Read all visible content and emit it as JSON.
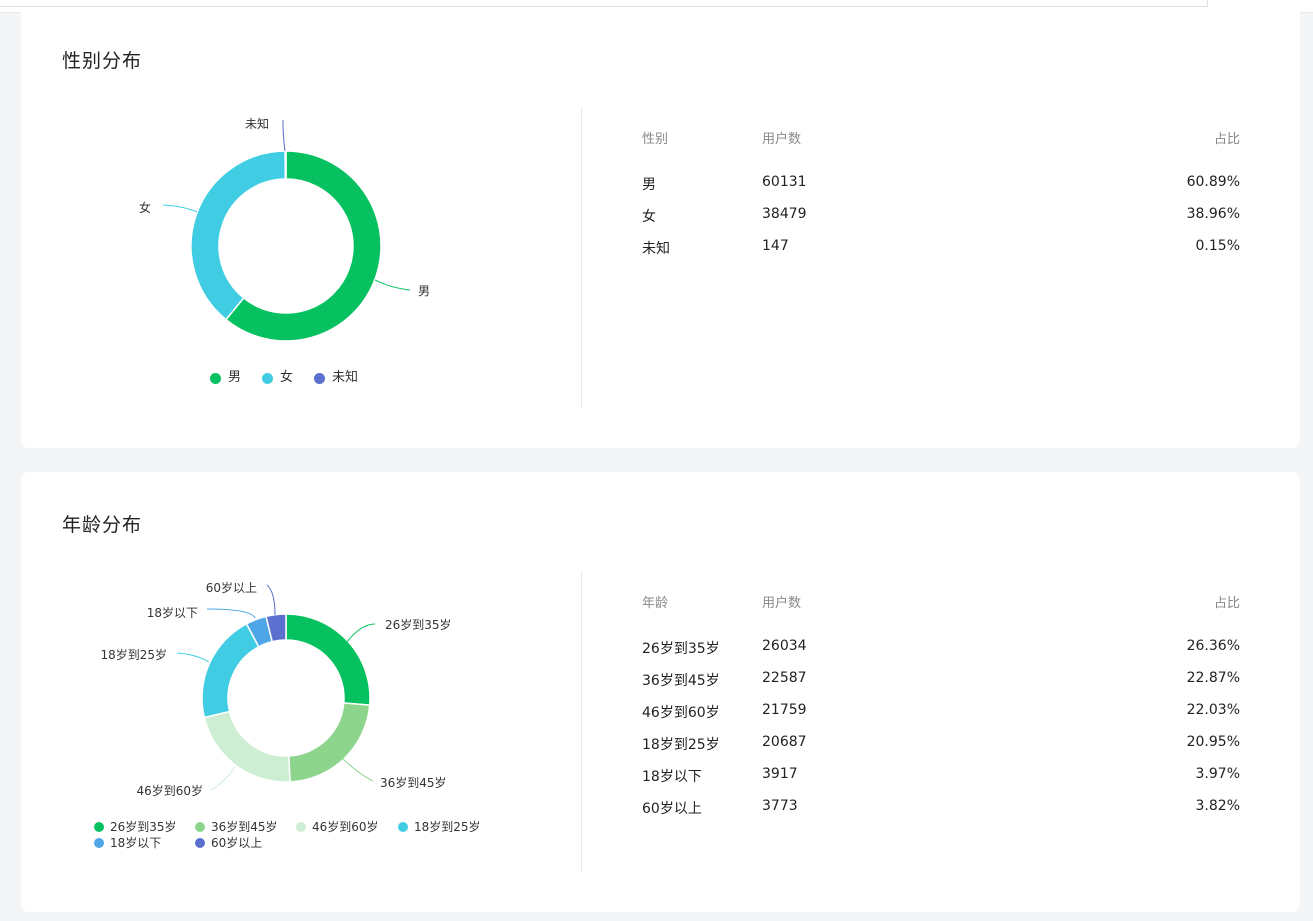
{
  "gender": {
    "title": "性别分布",
    "table": {
      "headers": [
        "性别",
        "用户数",
        "占比"
      ],
      "rows": [
        {
          "label": "男",
          "count": "60131",
          "pct": "60.89%"
        },
        {
          "label": "女",
          "count": "38479",
          "pct": "38.96%"
        },
        {
          "label": "未知",
          "count": "147",
          "pct": "0.15%"
        }
      ]
    }
  },
  "age": {
    "title": "年龄分布",
    "table": {
      "headers": [
        "年龄",
        "用户数",
        "占比"
      ],
      "rows": [
        {
          "label": "26岁到35岁",
          "count": "26034",
          "pct": "26.36%"
        },
        {
          "label": "36岁到45岁",
          "count": "22587",
          "pct": "22.87%"
        },
        {
          "label": "46岁到60岁",
          "count": "21759",
          "pct": "22.03%"
        },
        {
          "label": "18岁到25岁",
          "count": "20687",
          "pct": "20.95%"
        },
        {
          "label": "18岁以下",
          "count": "3917",
          "pct": "3.97%"
        },
        {
          "label": "60岁以上",
          "count": "3773",
          "pct": "3.82%"
        }
      ]
    }
  },
  "chart_data": [
    {
      "type": "pie",
      "variant": "donut",
      "title": "性别分布",
      "legend_position": "bottom",
      "slices": [
        {
          "label": "男",
          "value": 60131,
          "color": "#07c160"
        },
        {
          "label": "女",
          "value": 38479,
          "color": "#40cde3"
        },
        {
          "label": "未知",
          "value": 147,
          "color": "#5b6fce"
        }
      ]
    },
    {
      "type": "pie",
      "variant": "donut",
      "title": "年龄分布",
      "legend_position": "bottom",
      "slices": [
        {
          "label": "26岁到35岁",
          "value": 26034,
          "color": "#07c160"
        },
        {
          "label": "36岁到45岁",
          "value": 22587,
          "color": "#8dd58c"
        },
        {
          "label": "46岁到60岁",
          "value": 21759,
          "color": "#cdeed3"
        },
        {
          "label": "18岁到25岁",
          "value": 20687,
          "color": "#40cde3"
        },
        {
          "label": "18岁以下",
          "value": 3917,
          "color": "#4ea6e6"
        },
        {
          "label": "60岁以上",
          "value": 3773,
          "color": "#5b6fce"
        }
      ]
    }
  ]
}
